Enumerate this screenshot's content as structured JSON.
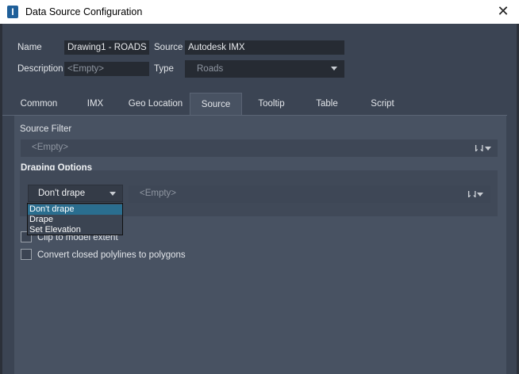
{
  "window": {
    "title": "Data Source Configuration",
    "close_glyph": "✕",
    "app_icon": "I"
  },
  "form": {
    "name_label": "Name",
    "name_value": "Drawing1 - ROADS",
    "source_label": "Source",
    "source_value": "Autodesk IMX",
    "description_label": "Description",
    "description_placeholder": "<Empty>",
    "type_label": "Type",
    "type_value": "Roads"
  },
  "tabs": [
    {
      "label": "Common"
    },
    {
      "label": "IMX"
    },
    {
      "label": "Geo Location"
    },
    {
      "label": "Source",
      "active": true
    },
    {
      "label": "Tooltip"
    },
    {
      "label": "Table"
    },
    {
      "label": "Script"
    }
  ],
  "source_tab": {
    "source_filter_label": "Source Filter",
    "source_filter_placeholder": "<Empty>",
    "filter_icon": "filter-icon",
    "draping_title": "Draping Options",
    "drape_selected": "Don't drape",
    "drape_value_placeholder": "<Empty>",
    "drape_options": [
      "Don't drape",
      "Drape",
      "Set Elevation"
    ],
    "clip_label": "Clip to model extent",
    "clip_checked": false,
    "convert_label": "Convert closed polylines to polygons",
    "convert_checked": false
  },
  "colors": {
    "background": "#3b4453",
    "panel": "#485262",
    "field": "#262b33",
    "selection": "#2a6e8f"
  }
}
